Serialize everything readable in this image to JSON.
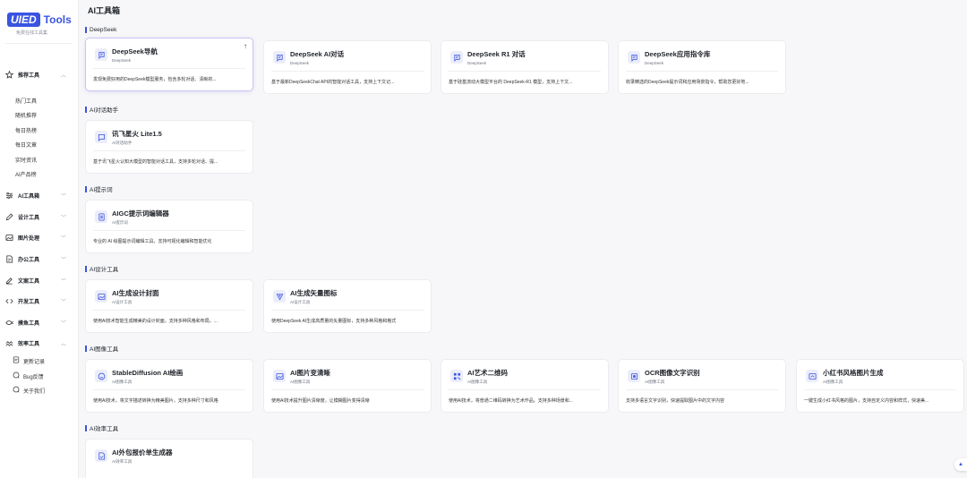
{
  "brand": {
    "badge": "UIED",
    "name": "Tools",
    "subtitle": "免费在线工具集"
  },
  "sidebar": {
    "recommend": {
      "label": "推荐工具",
      "icon": "star-icon"
    },
    "sub_items": [
      "热门工具",
      "随机推荐",
      "每日热榜",
      "每日文章",
      "实时资讯",
      "AI产品榜"
    ],
    "groups": [
      {
        "label": "AI工具箱",
        "icon": "sliders-icon"
      },
      {
        "label": "设计工具",
        "icon": "pen-icon"
      },
      {
        "label": "图片处理",
        "icon": "image-icon"
      },
      {
        "label": "办公工具",
        "icon": "document-icon"
      },
      {
        "label": "文案工具",
        "icon": "edit-icon"
      },
      {
        "label": "开发工具",
        "icon": "code-icon"
      },
      {
        "label": "摸鱼工具",
        "icon": "fish-icon"
      },
      {
        "label": "效率工具",
        "icon": "efficiency-icon"
      }
    ],
    "extras": [
      {
        "label": "更新记录",
        "icon": "update-log-icon"
      },
      {
        "label": "Bug反馈",
        "icon": "bug-icon"
      },
      {
        "label": "关于我们",
        "icon": "info-icon"
      }
    ]
  },
  "main": {
    "title": "AI工具箱",
    "sections": [
      {
        "name": "DeepSeek",
        "cards": [
          {
            "title": "DeepSeek导航",
            "category": "DeepSeek",
            "desc": "发现免费好用的DeepSeek模型服务，包含多轮对话、清晰的...",
            "icon": "chat-doc-icon"
          },
          {
            "title": "DeepSeek AI对话",
            "category": "DeepSeek",
            "desc": "基于最新DeepSeekChat API的智能对话工具，支持上下文记...",
            "icon": "chat-doc-icon"
          },
          {
            "title": "DeepSeek R1 对话",
            "category": "DeepSeek",
            "desc": "基于硅基流动大模型平台的 DeepSeek-R1 模型，支持上下文...",
            "icon": "chat-doc-icon"
          },
          {
            "title": "DeepSeek应用指令库",
            "category": "DeepSeek",
            "desc": "收录精选的DeepSeek提示词和应用场景指令，帮助您更好地...",
            "icon": "chat-doc-icon"
          }
        ]
      },
      {
        "name": "AI对话助手",
        "cards": [
          {
            "title": "讯飞星火 Lite1.5",
            "category": "AI对话助手",
            "desc": "基于讯飞星火认知大模型的智能对话工具，支持多轮对话、提...",
            "icon": "message-icon"
          }
        ]
      },
      {
        "name": "AI提示词",
        "cards": [
          {
            "title": "AIGC提示词编辑器",
            "category": "AI提示词",
            "desc": "专业的 AI 绘图提示词编辑工具，支持可视化编辑和智能优化",
            "icon": "list-icon"
          }
        ]
      },
      {
        "name": "AI设计工具",
        "cards": [
          {
            "title": "AI生成设计封面",
            "category": "AI设计工具",
            "desc": "使用AI技术智能生成精美的设计封面，支持多种风格和布局。...",
            "icon": "picture-icon"
          },
          {
            "title": "AI生成矢量图标",
            "category": "AI设计工具",
            "desc": "使用DeepSeek AI生成高质量的矢量图标，支持多种风格和格式",
            "icon": "vector-icon"
          }
        ]
      },
      {
        "name": "AI图像工具",
        "cards": [
          {
            "title": "StableDiffusion AI绘画",
            "category": "AI图像工具",
            "desc": "使用AI技术，将文字描述转换为精美图片，支持多种尺寸和风格",
            "icon": "smile-icon"
          },
          {
            "title": "AI图片变清晰",
            "category": "AI图像工具",
            "desc": "使用AI技术提升图片清晰度，让模糊图片变得清晰",
            "icon": "picture-icon"
          },
          {
            "title": "AI艺术二维码",
            "category": "AI图像工具",
            "desc": "使用AI技术，将普通二维码转换为艺术作品。支持多种场景和...",
            "icon": "qrcode-icon"
          },
          {
            "title": "OCR图像文字识别",
            "category": "AI图像工具",
            "desc": "支持多语言文字识别，快速提取图片中的文字内容",
            "icon": "scan-icon"
          },
          {
            "title": "小红书风格图片生成",
            "category": "AI图像工具",
            "desc": "一键生成小红书风格的图片，支持自定义内容和样式，快速美...",
            "icon": "magic-image-icon"
          }
        ]
      },
      {
        "name": "AI效率工具",
        "cards": [
          {
            "title": "AI外包报价单生成器",
            "category": "AI效率工具",
            "desc": "",
            "icon": "quote-doc-icon"
          }
        ]
      }
    ]
  },
  "colors": {
    "accent": "#3a54e0",
    "icon_bg": "#ecedfb"
  }
}
